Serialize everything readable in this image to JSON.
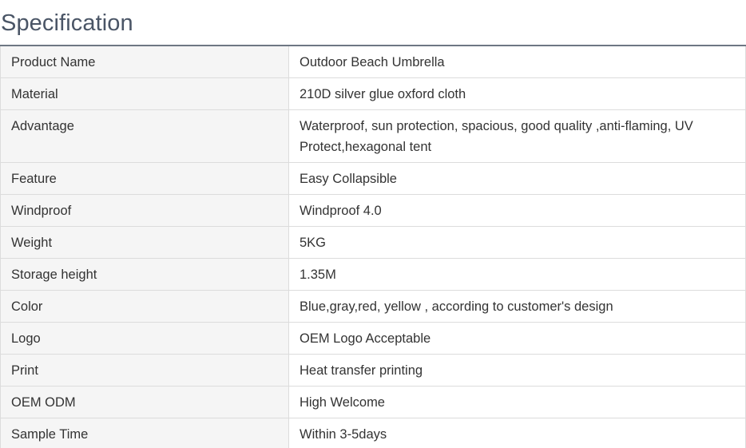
{
  "heading": "Specification",
  "rows": [
    {
      "label": "Product Name",
      "value": "Outdoor Beach Umbrella"
    },
    {
      "label": "Material",
      "value": "210D silver glue oxford cloth"
    },
    {
      "label": "Advantage",
      "value": "Waterproof, sun protection, spacious, good quality ,anti-flaming, UV Protect,hexagonal tent"
    },
    {
      "label": "Feature",
      "value": "Easy Collapsible"
    },
    {
      "label": "Windproof",
      "value": "Windproof 4.0"
    },
    {
      "label": "Weight",
      "value": "5KG"
    },
    {
      "label": "Storage height",
      "value": "1.35M"
    },
    {
      "label": "Color",
      "value": "Blue,gray,red, yellow , according to customer's design"
    },
    {
      "label": "Logo",
      "value": "OEM Logo Acceptable"
    },
    {
      "label": "Print",
      "value": "Heat transfer printing"
    },
    {
      "label": "OEM ODM",
      "value": "High Welcome"
    },
    {
      "label": "Sample Time",
      "value": "Within 3-5days"
    }
  ]
}
